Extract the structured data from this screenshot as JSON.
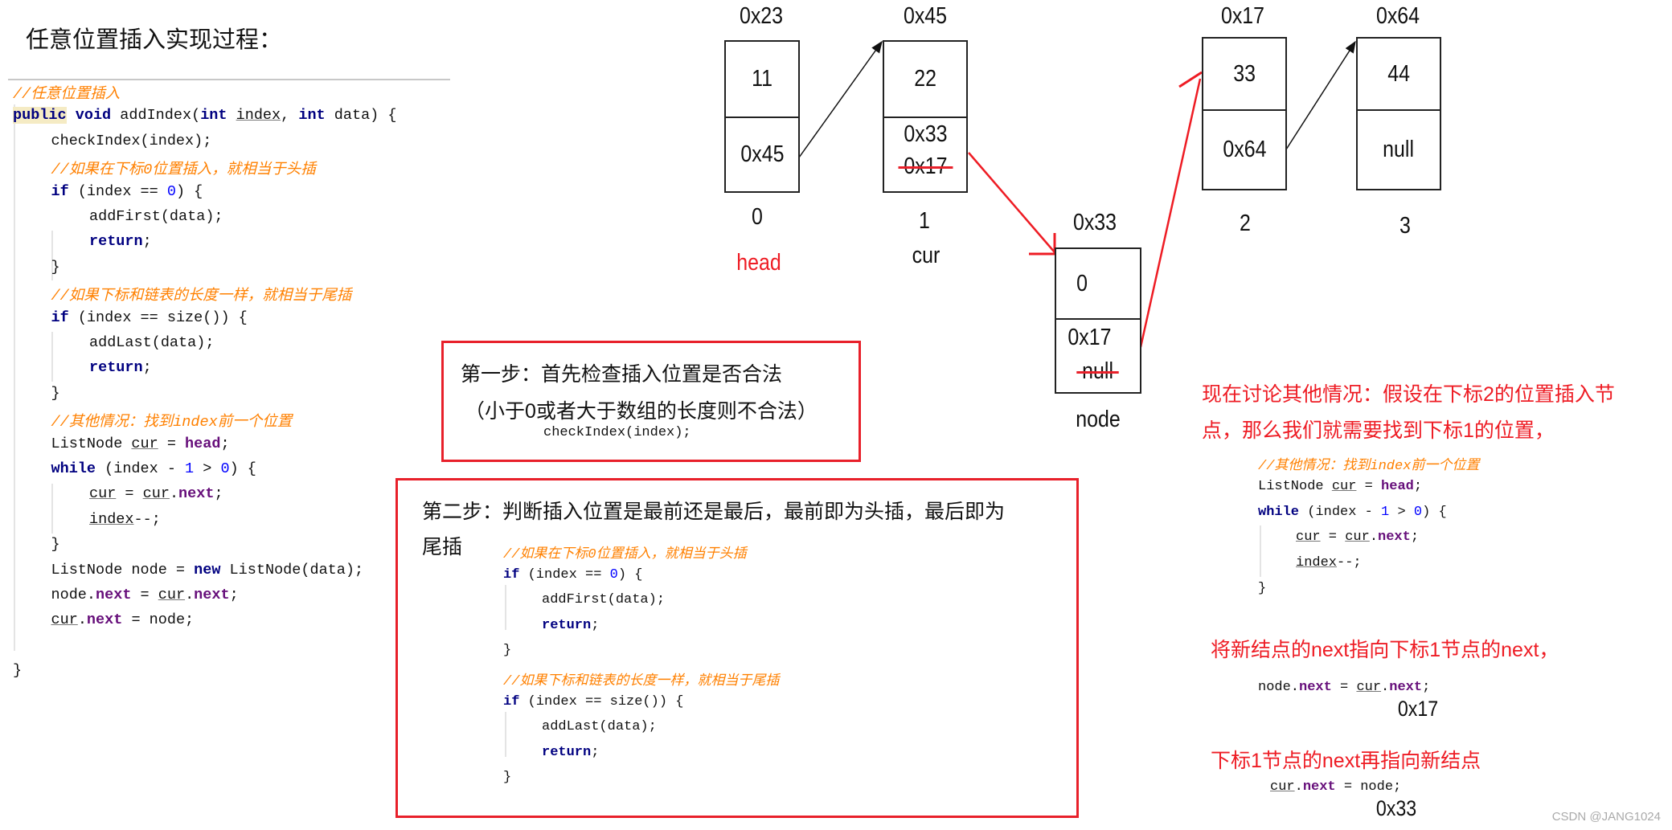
{
  "title": "任意位置插入实现过程：",
  "main_code": [
    {
      "i": 0,
      "s": [
        [
          "//任意位置插入",
          "cm"
        ]
      ]
    },
    {
      "i": 0,
      "s": [
        [
          "public",
          "kw hl"
        ],
        [
          " "
        ],
        [
          "void",
          "kw"
        ],
        [
          " addIndex("
        ],
        [
          "int",
          "kw"
        ],
        [
          " "
        ],
        [
          "index",
          "u"
        ],
        [
          ", "
        ],
        [
          "int",
          "kw"
        ],
        [
          " data) {"
        ]
      ]
    },
    {
      "i": 1,
      "s": [
        [
          "checkIndex(index);"
        ]
      ]
    },
    {
      "i": 1,
      "s": [
        [
          "//如果在下标0位置插入，就相当于头插",
          "cm"
        ]
      ]
    },
    {
      "i": 1,
      "s": [
        [
          "if",
          "kw"
        ],
        [
          " (index == "
        ],
        [
          "0",
          "num"
        ],
        [
          ") {"
        ]
      ]
    },
    {
      "i": 2,
      "s": [
        [
          "addFirst(data);"
        ]
      ]
    },
    {
      "i": 2,
      "s": [
        [
          "return",
          "kw"
        ],
        [
          ";"
        ]
      ]
    },
    {
      "i": 1,
      "s": [
        [
          "}"
        ]
      ]
    },
    {
      "i": 1,
      "s": [
        [
          "//如果下标和链表的长度一样，就相当于尾插",
          "cm"
        ]
      ]
    },
    {
      "i": 1,
      "s": [
        [
          "if",
          "kw"
        ],
        [
          " (index == size()) {"
        ]
      ]
    },
    {
      "i": 2,
      "s": [
        [
          "addLast(data);"
        ]
      ]
    },
    {
      "i": 2,
      "s": [
        [
          "return",
          "kw"
        ],
        [
          ";"
        ]
      ]
    },
    {
      "i": 1,
      "s": [
        [
          "}"
        ]
      ]
    },
    {
      "i": 1,
      "s": [
        [
          "//其他情况：找到index前一个位置",
          "cm"
        ]
      ]
    },
    {
      "i": 1,
      "s": [
        [
          "ListNode "
        ],
        [
          "cur",
          "u"
        ],
        [
          " = "
        ],
        [
          "head",
          "fld"
        ],
        [
          ";"
        ]
      ]
    },
    {
      "i": 1,
      "s": [
        [
          "while",
          "kw"
        ],
        [
          " (index - "
        ],
        [
          "1",
          "num"
        ],
        [
          " > "
        ],
        [
          "0",
          "num"
        ],
        [
          ") {"
        ]
      ]
    },
    {
      "i": 2,
      "s": [
        [
          "cur",
          "u"
        ],
        [
          " = "
        ],
        [
          "cur",
          "u"
        ],
        [
          "."
        ],
        [
          "next",
          "fld"
        ],
        [
          ";"
        ]
      ]
    },
    {
      "i": 2,
      "s": [
        [
          "index",
          "u"
        ],
        [
          "--;"
        ]
      ]
    },
    {
      "i": 1,
      "s": [
        [
          "}"
        ]
      ]
    },
    {
      "i": 1,
      "s": [
        [
          "ListNode node = "
        ],
        [
          "new",
          "kw"
        ],
        [
          " ListNode(data);"
        ]
      ]
    },
    {
      "i": 1,
      "s": [
        [
          "node."
        ],
        [
          "next",
          "fld"
        ],
        [
          " = "
        ],
        [
          "cur",
          "u"
        ],
        [
          "."
        ],
        [
          "next",
          "fld"
        ],
        [
          ";"
        ]
      ]
    },
    {
      "i": 1,
      "s": [
        [
          "cur",
          "u"
        ],
        [
          "."
        ],
        [
          "next",
          "fld"
        ],
        [
          " = node;"
        ]
      ]
    },
    {
      "i": 1,
      "s": [
        [
          ""
        ]
      ]
    },
    {
      "i": 0,
      "s": [
        [
          "}"
        ]
      ]
    }
  ],
  "diagram": {
    "nodes": [
      {
        "address": "0x23",
        "data": "11",
        "next": "0x45",
        "index": "0",
        "label": "head",
        "label_color": "#ee1c24"
      },
      {
        "address": "0x45",
        "data": "22",
        "next": "0x33",
        "struck_next": "0x17",
        "index": "1",
        "label": "cur",
        "label_color": "#111111"
      },
      {
        "address": "0x17",
        "data": "33",
        "next": "0x64",
        "index": "2"
      },
      {
        "address": "0x64",
        "data": "44",
        "next": "null",
        "index": "3"
      }
    ],
    "new_node": {
      "address": "0x33",
      "data": "0",
      "next": "0x17",
      "struck_next": "null",
      "label": "node"
    },
    "arrow_colors": {
      "existing": "#111111",
      "new": "#ee1c24"
    }
  },
  "step1": {
    "line1": "第一步：首先检查插入位置是否合法",
    "line2": "（小于0或者大于数组的长度则不合法）",
    "code": "checkIndex(index);"
  },
  "step2": {
    "line1": "第二步：判断插入位置是最前还是最后，最前即为头插，最后即为",
    "line2": "尾插",
    "code": [
      {
        "i": 0,
        "s": [
          [
            "//如果在下标0位置插入，就相当于头插",
            "cm"
          ]
        ]
      },
      {
        "i": 0,
        "s": [
          [
            "if",
            "kw"
          ],
          [
            " (index == "
          ],
          [
            "0",
            "num"
          ],
          [
            ") {"
          ]
        ]
      },
      {
        "i": 1,
        "s": [
          [
            "addFirst(data);"
          ]
        ]
      },
      {
        "i": 1,
        "s": [
          [
            "return",
            "kw"
          ],
          [
            ";"
          ]
        ]
      },
      {
        "i": 0,
        "s": [
          [
            "}"
          ]
        ]
      },
      {
        "i": 0,
        "s": [
          [
            "//如果下标和链表的长度一样，就相当于尾插",
            "cm"
          ]
        ]
      },
      {
        "i": 0,
        "s": [
          [
            "if",
            "kw"
          ],
          [
            " (index == size()) {"
          ]
        ]
      },
      {
        "i": 1,
        "s": [
          [
            "addLast(data);"
          ]
        ]
      },
      {
        "i": 1,
        "s": [
          [
            "return",
            "kw"
          ],
          [
            ";"
          ]
        ]
      },
      {
        "i": 0,
        "s": [
          [
            "}"
          ]
        ]
      }
    ]
  },
  "explanation": {
    "line1": "现在讨论其他情况：假设在下标2的位置插入节",
    "line2": "点，那么我们就需要找到下标1的位置，",
    "code": [
      {
        "i": 0,
        "s": [
          [
            "//其他情况：找到index前一个位置",
            "cm"
          ]
        ]
      },
      {
        "i": 0,
        "s": [
          [
            "ListNode "
          ],
          [
            "cur",
            "u"
          ],
          [
            " = "
          ],
          [
            "head",
            "fld"
          ],
          [
            ";"
          ]
        ]
      },
      {
        "i": 0,
        "s": [
          [
            "while",
            "kw"
          ],
          [
            " (index - "
          ],
          [
            "1",
            "num"
          ],
          [
            " > "
          ],
          [
            "0",
            "num"
          ],
          [
            ") {"
          ]
        ]
      },
      {
        "i": 1,
        "s": [
          [
            "cur",
            "u"
          ],
          [
            " = "
          ],
          [
            "cur",
            "u"
          ],
          [
            "."
          ],
          [
            "next",
            "fld"
          ],
          [
            ";"
          ]
        ]
      },
      {
        "i": 1,
        "s": [
          [
            "index",
            "u"
          ],
          [
            "--;"
          ]
        ]
      },
      {
        "i": 0,
        "s": [
          [
            "}"
          ]
        ]
      }
    ],
    "step_a": "将新结点的next指向下标1节点的next，",
    "code_a": [
      {
        "i": 0,
        "s": [
          [
            "node."
          ],
          [
            "next",
            "fld"
          ],
          [
            " = "
          ],
          [
            "cur",
            "u"
          ],
          [
            "."
          ],
          [
            "next",
            "fld"
          ],
          [
            ";"
          ]
        ]
      }
    ],
    "value_a": "0x17",
    "step_b": "下标1节点的next再指向新结点",
    "code_b": [
      {
        "i": 0,
        "s": [
          [
            "cur",
            "u"
          ],
          [
            "."
          ],
          [
            "next",
            "fld"
          ],
          [
            " = node;"
          ]
        ]
      }
    ],
    "value_b": "0x33"
  },
  "watermark": "CSDN @JANG1024"
}
